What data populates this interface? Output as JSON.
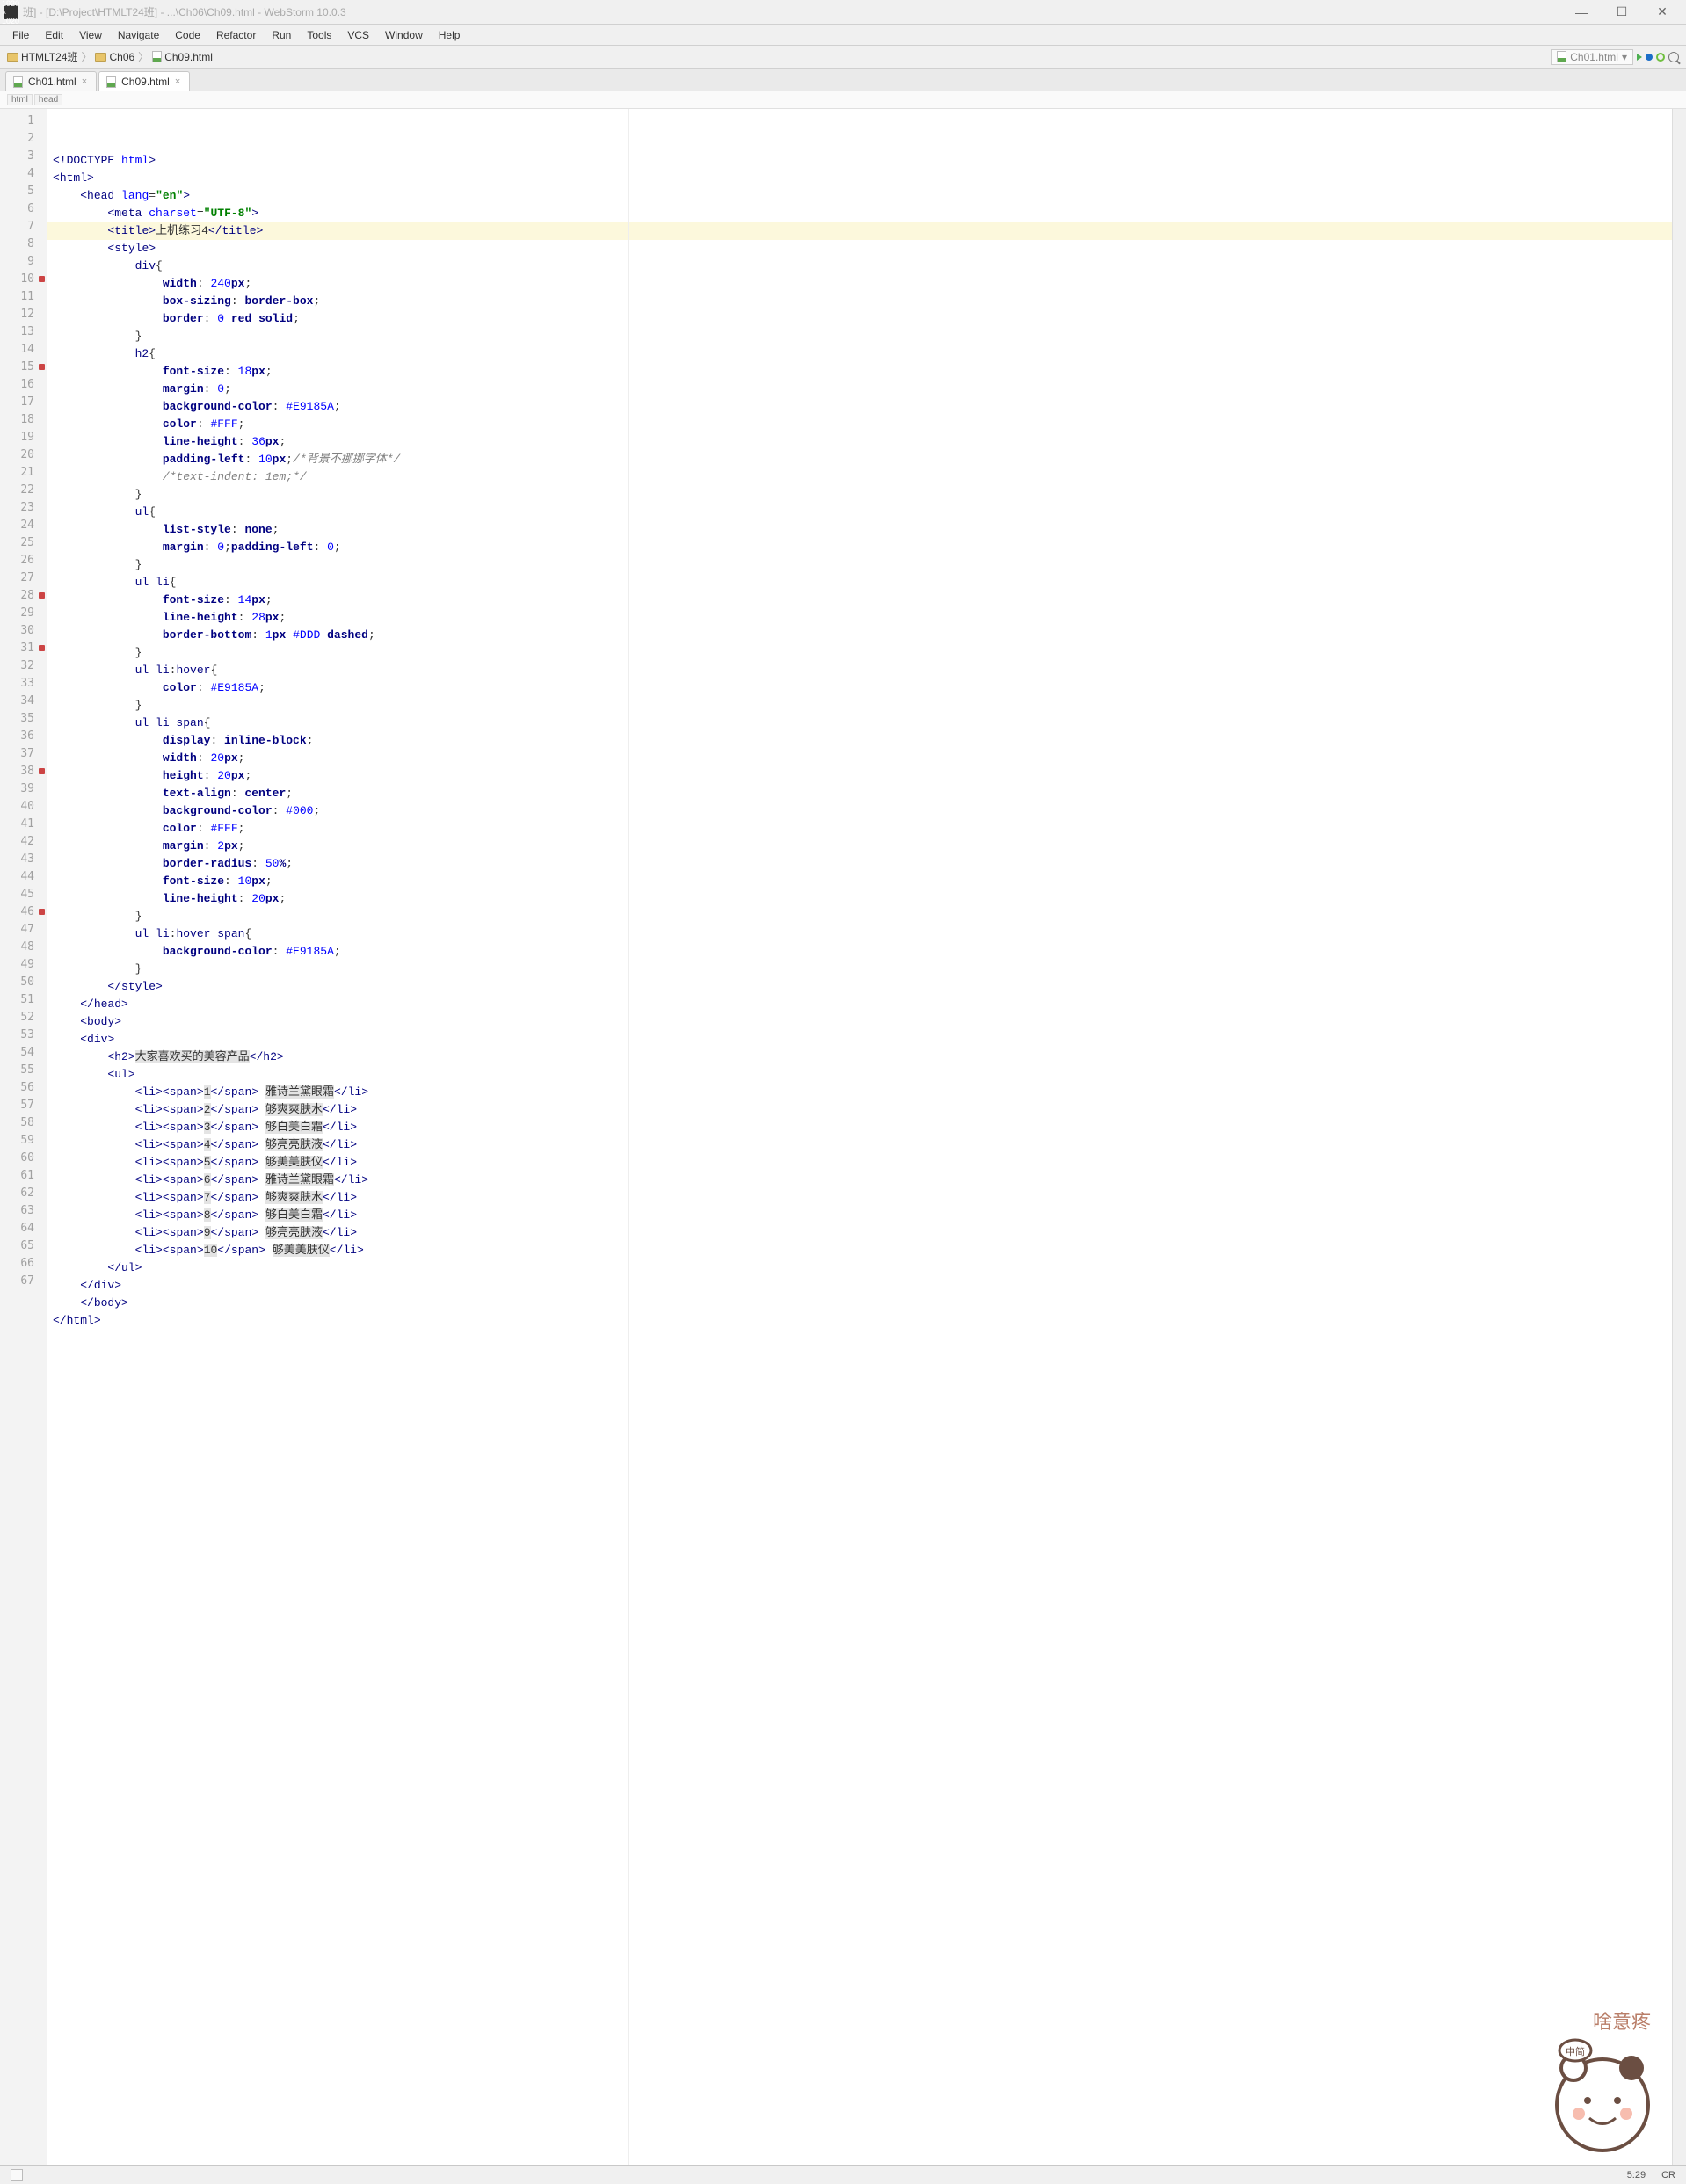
{
  "titlebar": {
    "dim_badge": "1920 × 1020",
    "text_suffix": "班] - [D:\\Project\\HTMLT24班] - ...\\Ch06\\Ch09.html - WebStorm 10.0.3"
  },
  "menu": [
    "File",
    "Edit",
    "View",
    "Navigate",
    "Code",
    "Refactor",
    "Run",
    "Tools",
    "VCS",
    "Window",
    "Help"
  ],
  "nav": {
    "crumb1": "HTMLT24班",
    "crumb2": "Ch06",
    "crumb3": "Ch09.html",
    "right_file": "Ch01.html"
  },
  "tabs": [
    {
      "label": "Ch01.html",
      "active": false
    },
    {
      "label": "Ch09.html",
      "active": true
    }
  ],
  "breadcrumb2": [
    "html",
    "head"
  ],
  "gutter_bp": [
    10,
    15,
    28,
    31,
    38,
    46
  ],
  "code_lines": [
    {
      "n": 1,
      "hl": false,
      "html": "<span class='k'>&lt;!</span><span class='t'>DOCTYPE </span><span class='a'>html</span><span class='k'>&gt;</span>"
    },
    {
      "n": 2,
      "hl": false,
      "html": "<span class='k'>&lt;</span><span class='t'>html</span><span class='k'>&gt;</span>"
    },
    {
      "n": 3,
      "hl": false,
      "html": "    <span class='k'>&lt;</span><span class='t'>head </span><span class='a'>lang</span>=<span class='s'>\"en\"</span><span class='k'>&gt;</span>"
    },
    {
      "n": 4,
      "hl": false,
      "html": "        <span class='k'>&lt;</span><span class='t'>meta </span><span class='a'>charset</span>=<span class='s'>\"UTF-8\"</span><span class='k'>&gt;</span>"
    },
    {
      "n": 5,
      "hl": true,
      "html": "        <span class='k'>&lt;</span><span class='t'>title</span><span class='k'>&gt;</span>上机练习4<span class='k'>&lt;/</span><span class='t'>title</span><span class='k'>&gt;</span>"
    },
    {
      "n": 6,
      "hl": false,
      "html": "        <span class='k'>&lt;</span><span class='t'>style</span><span class='k'>&gt;</span>"
    },
    {
      "n": 7,
      "hl": false,
      "html": "            <span class='sel'>div</span>{"
    },
    {
      "n": 8,
      "hl": false,
      "html": "                <span class='p'>width</span>: <span class='n'>240</span><span class='p'>px</span>;"
    },
    {
      "n": 9,
      "hl": false,
      "html": "                <span class='p'>box-sizing</span>: <span class='p'>border-box</span>;"
    },
    {
      "n": 10,
      "hl": false,
      "html": "                <span class='p'>border</span>: <span class='n'>0</span> <span class='p'>red solid</span>;"
    },
    {
      "n": 11,
      "hl": false,
      "html": "            }"
    },
    {
      "n": 12,
      "hl": false,
      "html": "            <span class='sel'>h2</span>{"
    },
    {
      "n": 13,
      "hl": false,
      "html": "                <span class='p'>font-size</span>: <span class='n'>18</span><span class='p'>px</span>;"
    },
    {
      "n": 14,
      "hl": false,
      "html": "                <span class='p'>margin</span>: <span class='n'>0</span>;"
    },
    {
      "n": 15,
      "hl": false,
      "html": "                <span class='p'>background-color</span>: <span class='n'>#E9185A</span>;"
    },
    {
      "n": 16,
      "hl": false,
      "html": "                <span class='p'>color</span>: <span class='n'>#FFF</span>;"
    },
    {
      "n": 17,
      "hl": false,
      "html": "                <span class='p'>line-height</span>: <span class='n'>36</span><span class='p'>px</span>;"
    },
    {
      "n": 18,
      "hl": false,
      "html": "                <span class='p'>padding-left</span>: <span class='n'>10</span><span class='p'>px</span>;<span class='c'>/*背景不挪挪字体*/</span>"
    },
    {
      "n": 19,
      "hl": false,
      "html": "                <span class='c'>/*text-indent: 1em;*/</span>"
    },
    {
      "n": 20,
      "hl": false,
      "html": "            }"
    },
    {
      "n": 21,
      "hl": false,
      "html": "            <span class='sel'>ul</span>{"
    },
    {
      "n": 22,
      "hl": false,
      "html": "                <span class='p'>list-style</span>: <span class='p'>none</span>;"
    },
    {
      "n": 23,
      "hl": false,
      "html": "                <span class='p'>margin</span>: <span class='n'>0</span>;<span class='p'>padding-left</span>: <span class='n'>0</span>;"
    },
    {
      "n": 24,
      "hl": false,
      "html": "            }"
    },
    {
      "n": 25,
      "hl": false,
      "html": "            <span class='sel'>ul li</span>{"
    },
    {
      "n": 26,
      "hl": false,
      "html": "                <span class='p'>font-size</span>: <span class='n'>14</span><span class='p'>px</span>;"
    },
    {
      "n": 27,
      "hl": false,
      "html": "                <span class='p'>line-height</span>: <span class='n'>28</span><span class='p'>px</span>;"
    },
    {
      "n": 28,
      "hl": false,
      "html": "                <span class='p'>border-bottom</span>: <span class='n'>1</span><span class='p'>px</span> <span class='n'>#DDD</span> <span class='p'>dashed</span>;"
    },
    {
      "n": 29,
      "hl": false,
      "html": "            }"
    },
    {
      "n": 30,
      "hl": false,
      "html": "            <span class='sel'>ul li</span>:<span class='sel'>hover</span>{"
    },
    {
      "n": 31,
      "hl": false,
      "html": "                <span class='p'>color</span>: <span class='n'>#E9185A</span>;"
    },
    {
      "n": 32,
      "hl": false,
      "html": "            }"
    },
    {
      "n": 33,
      "hl": false,
      "html": "            <span class='sel'>ul li span</span>{"
    },
    {
      "n": 34,
      "hl": false,
      "html": "                <span class='p'>display</span>: <span class='p'>inline-block</span>;"
    },
    {
      "n": 35,
      "hl": false,
      "html": "                <span class='p'>width</span>: <span class='n'>20</span><span class='p'>px</span>;"
    },
    {
      "n": 36,
      "hl": false,
      "html": "                <span class='p'>height</span>: <span class='n'>20</span><span class='p'>px</span>;"
    },
    {
      "n": 37,
      "hl": false,
      "html": "                <span class='p'>text-align</span>: <span class='p'>center</span>;"
    },
    {
      "n": 38,
      "hl": false,
      "html": "                <span class='p'>background-color</span>: <span class='n'>#000</span>;"
    },
    {
      "n": 39,
      "hl": false,
      "html": "                <span class='p'>color</span>: <span class='n'>#FFF</span>;"
    },
    {
      "n": 40,
      "hl": false,
      "html": "                <span class='p'>margin</span>: <span class='n'>2</span><span class='p'>px</span>;"
    },
    {
      "n": 41,
      "hl": false,
      "html": "                <span class='p'>border-radius</span>: <span class='n'>50</span><span class='p'>%</span>;"
    },
    {
      "n": 42,
      "hl": false,
      "html": "                <span class='p'>font-size</span>: <span class='n'>10</span><span class='p'>px</span>;"
    },
    {
      "n": 43,
      "hl": false,
      "html": "                <span class='p'>line-height</span>: <span class='n'>20</span><span class='p'>px</span>;"
    },
    {
      "n": 44,
      "hl": false,
      "html": "            }"
    },
    {
      "n": 45,
      "hl": false,
      "html": "            <span class='sel'>ul li</span>:<span class='sel'>hover span</span>{"
    },
    {
      "n": 46,
      "hl": false,
      "html": "                <span class='p'>background-color</span>: <span class='n'>#E9185A</span>;"
    },
    {
      "n": 47,
      "hl": false,
      "html": "            }"
    },
    {
      "n": 48,
      "hl": false,
      "html": "        <span class='k'>&lt;/</span><span class='t'>style</span><span class='k'>&gt;</span>"
    },
    {
      "n": 49,
      "hl": false,
      "html": "    <span class='k'>&lt;/</span><span class='t'>head</span><span class='k'>&gt;</span>"
    },
    {
      "n": 50,
      "hl": false,
      "html": "    <span class='k'>&lt;</span><span class='t'>body</span><span class='k'>&gt;</span>"
    },
    {
      "n": 51,
      "hl": false,
      "html": "    <span class='k'>&lt;</span><span class='t'>div</span><span class='k'>&gt;</span>"
    },
    {
      "n": 52,
      "hl": false,
      "html": "        <span class='k'>&lt;</span><span class='t'>h2</span><span class='k'>&gt;</span><span class='bghl'>大家喜欢买的美容产品</span><span class='k'>&lt;/</span><span class='t'>h2</span><span class='k'>&gt;</span>"
    },
    {
      "n": 53,
      "hl": false,
      "html": "        <span class='k'>&lt;</span><span class='t'>ul</span><span class='k'>&gt;</span>"
    },
    {
      "n": 54,
      "hl": false,
      "html": "            <span class='k'>&lt;</span><span class='t'>li</span><span class='k'>&gt;&lt;</span><span class='t'>span</span><span class='k'>&gt;</span><span class='bghl'>1</span><span class='k'>&lt;/</span><span class='t'>span</span><span class='k'>&gt;</span> <span class='bghl'>雅诗兰黛眼霜</span><span class='k'>&lt;/</span><span class='t'>li</span><span class='k'>&gt;</span>"
    },
    {
      "n": 55,
      "hl": false,
      "html": "            <span class='k'>&lt;</span><span class='t'>li</span><span class='k'>&gt;&lt;</span><span class='t'>span</span><span class='k'>&gt;</span><span class='bghl'>2</span><span class='k'>&lt;/</span><span class='t'>span</span><span class='k'>&gt;</span> <span class='bghl'>够爽爽肤水</span><span class='k'>&lt;/</span><span class='t'>li</span><span class='k'>&gt;</span>"
    },
    {
      "n": 56,
      "hl": false,
      "html": "            <span class='k'>&lt;</span><span class='t'>li</span><span class='k'>&gt;&lt;</span><span class='t'>span</span><span class='k'>&gt;</span><span class='bghl'>3</span><span class='k'>&lt;/</span><span class='t'>span</span><span class='k'>&gt;</span> <span class='bghl'>够白美白霜</span><span class='k'>&lt;/</span><span class='t'>li</span><span class='k'>&gt;</span>"
    },
    {
      "n": 57,
      "hl": false,
      "html": "            <span class='k'>&lt;</span><span class='t'>li</span><span class='k'>&gt;&lt;</span><span class='t'>span</span><span class='k'>&gt;</span><span class='bghl'>4</span><span class='k'>&lt;/</span><span class='t'>span</span><span class='k'>&gt;</span> <span class='bghl'>够亮亮肤液</span><span class='k'>&lt;/</span><span class='t'>li</span><span class='k'>&gt;</span>"
    },
    {
      "n": 58,
      "hl": false,
      "html": "            <span class='k'>&lt;</span><span class='t'>li</span><span class='k'>&gt;&lt;</span><span class='t'>span</span><span class='k'>&gt;</span><span class='bghl'>5</span><span class='k'>&lt;/</span><span class='t'>span</span><span class='k'>&gt;</span> <span class='bghl'>够美美肤仪</span><span class='k'>&lt;/</span><span class='t'>li</span><span class='k'>&gt;</span>"
    },
    {
      "n": 59,
      "hl": false,
      "html": "            <span class='k'>&lt;</span><span class='t'>li</span><span class='k'>&gt;&lt;</span><span class='t'>span</span><span class='k'>&gt;</span><span class='bghl'>6</span><span class='k'>&lt;/</span><span class='t'>span</span><span class='k'>&gt;</span> <span class='bghl'>雅诗兰黛眼霜</span><span class='k'>&lt;/</span><span class='t'>li</span><span class='k'>&gt;</span>"
    },
    {
      "n": 60,
      "hl": false,
      "html": "            <span class='k'>&lt;</span><span class='t'>li</span><span class='k'>&gt;&lt;</span><span class='t'>span</span><span class='k'>&gt;</span><span class='bghl'>7</span><span class='k'>&lt;/</span><span class='t'>span</span><span class='k'>&gt;</span> <span class='bghl'>够爽爽肤水</span><span class='k'>&lt;/</span><span class='t'>li</span><span class='k'>&gt;</span>"
    },
    {
      "n": 61,
      "hl": false,
      "html": "            <span class='k'>&lt;</span><span class='t'>li</span><span class='k'>&gt;&lt;</span><span class='t'>span</span><span class='k'>&gt;</span><span class='bghl'>8</span><span class='k'>&lt;/</span><span class='t'>span</span><span class='k'>&gt;</span> <span class='bghl'>够白美白霜</span><span class='k'>&lt;/</span><span class='t'>li</span><span class='k'>&gt;</span>"
    },
    {
      "n": 62,
      "hl": false,
      "html": "            <span class='k'>&lt;</span><span class='t'>li</span><span class='k'>&gt;&lt;</span><span class='t'>span</span><span class='k'>&gt;</span><span class='bghl'>9</span><span class='k'>&lt;/</span><span class='t'>span</span><span class='k'>&gt;</span> <span class='bghl'>够亮亮肤液</span><span class='k'>&lt;/</span><span class='t'>li</span><span class='k'>&gt;</span>"
    },
    {
      "n": 63,
      "hl": false,
      "html": "            <span class='k'>&lt;</span><span class='t'>li</span><span class='k'>&gt;&lt;</span><span class='t'>span</span><span class='k'>&gt;</span><span class='bghl'>10</span><span class='k'>&lt;/</span><span class='t'>span</span><span class='k'>&gt;</span> <span class='bghl'>够美美肤仪</span><span class='k'>&lt;/</span><span class='t'>li</span><span class='k'>&gt;</span>"
    },
    {
      "n": 64,
      "hl": false,
      "html": "        <span class='k'>&lt;/</span><span class='t'>ul</span><span class='k'>&gt;</span>"
    },
    {
      "n": 65,
      "hl": false,
      "html": "    <span class='k'>&lt;/</span><span class='t'>div</span><span class='k'>&gt;</span>"
    },
    {
      "n": 66,
      "hl": false,
      "html": "    <span class='k'>&lt;/</span><span class='t'>body</span><span class='k'>&gt;</span>"
    },
    {
      "n": 67,
      "hl": false,
      "html": "<span class='k'>&lt;/</span><span class='t'>html</span><span class='k'>&gt;</span>"
    }
  ],
  "status": {
    "pos": "5:29",
    "enc": "CR"
  },
  "mascot_label": "啥意疼",
  "mascot_bubble": "中简"
}
